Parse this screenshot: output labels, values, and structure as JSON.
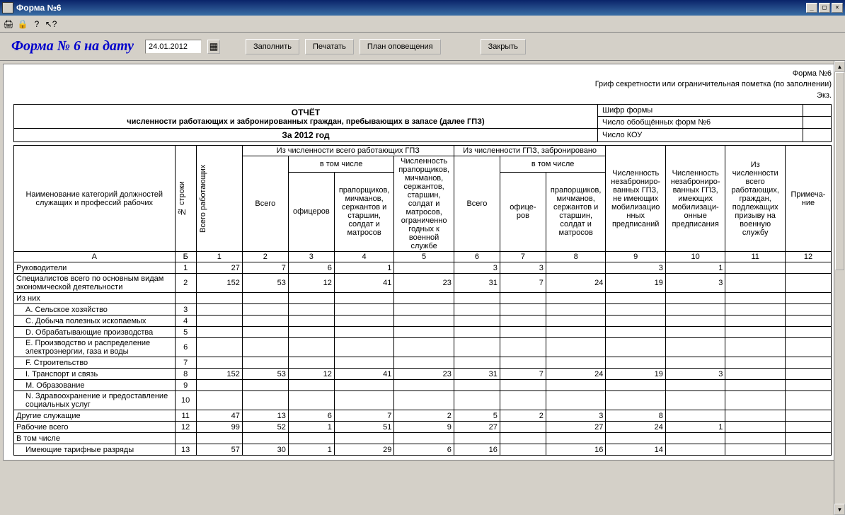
{
  "window": {
    "title": "Форма №6"
  },
  "toolbar_icons": [
    "print-icon",
    "lock-icon",
    "help-icon",
    "pointer-icon"
  ],
  "panel": {
    "title": "Форма № 6 на дату",
    "date": "24.01.2012",
    "fill_btn": "Заполнить",
    "print_btn": "Печатать",
    "plan_btn": "План оповещения",
    "close_btn": "Закрыть"
  },
  "header_right": {
    "line1": "Форма №6",
    "line2": "Гриф секретности или ограничительная пометка (по заполнении)",
    "line3": "Экз."
  },
  "report_header": {
    "title1": "ОТЧЁТ",
    "title2": "численности работающих и забронированных граждан, пребывающих в запасе (далее ГПЗ)",
    "title3": "За 2012 год",
    "meta": [
      {
        "label": "Шифр формы",
        "value": ""
      },
      {
        "label": "Число обобщённых форм №6",
        "value": ""
      },
      {
        "label": "Число КОУ",
        "value": ""
      }
    ]
  },
  "columns": {
    "name": "Наименование категорий должностей служащих и профессий рабочих",
    "row_no": "№ строки",
    "total": "Всего работающих",
    "group1": "Из численности всего работающих ГПЗ",
    "group2": "Из численности ГПЗ, забронировано",
    "subgroup": "в том числе",
    "vsego": "Всего",
    "officers": "офицеров",
    "prapor": "прапорщиков, мичманов, сержантов и старшин, солдат и матросов",
    "limited": "Численность прапорщиков, мичманов, сержантов, старшин, солдат и матросов, ограниченно годных к военной службе",
    "officers2": "офице- ров",
    "col9": "Численность незаброниро- ванных ГПЗ, не имеющих мобилизацио нных предписаний",
    "col10": "Численность незаброниро- ванных ГПЗ, имеющих мобилизаци- онные предписания",
    "col11": "Из численности всего работающих, граждан, подлежащих призыву на военную службу",
    "col12": "Примеча- ние",
    "letter_a": "А",
    "letter_b": "Б",
    "nums": [
      "1",
      "2",
      "3",
      "4",
      "5",
      "6",
      "7",
      "8",
      "9",
      "10",
      "11",
      "12"
    ]
  },
  "rows": [
    {
      "name": "Руководители",
      "indent": 0,
      "no": "1",
      "v": [
        "27",
        "7",
        "6",
        "1",
        "",
        "3",
        "3",
        "",
        "3",
        "1",
        "",
        ""
      ]
    },
    {
      "name": "Специалистов всего по основным видам экономической деятельности",
      "indent": 0,
      "no": "2",
      "v": [
        "152",
        "53",
        "12",
        "41",
        "23",
        "31",
        "7",
        "24",
        "19",
        "3",
        "",
        ""
      ]
    },
    {
      "name": "Из них",
      "indent": 0,
      "no": "",
      "v": [
        "",
        "",
        "",
        "",
        "",
        "",
        "",
        "",
        "",
        "",
        "",
        ""
      ]
    },
    {
      "name": "A. Сельское хозяйство",
      "indent": 1,
      "no": "3",
      "v": [
        "",
        "",
        "",
        "",
        "",
        "",
        "",
        "",
        "",
        "",
        "",
        ""
      ]
    },
    {
      "name": "C. Добыча полезных ископаемых",
      "indent": 1,
      "no": "4",
      "v": [
        "",
        "",
        "",
        "",
        "",
        "",
        "",
        "",
        "",
        "",
        "",
        ""
      ]
    },
    {
      "name": "D. Обрабатывающие производства",
      "indent": 1,
      "no": "5",
      "v": [
        "",
        "",
        "",
        "",
        "",
        "",
        "",
        "",
        "",
        "",
        "",
        ""
      ]
    },
    {
      "name": "E. Производство и распределение электроэнергии, газа и воды",
      "indent": 1,
      "no": "6",
      "v": [
        "",
        "",
        "",
        "",
        "",
        "",
        "",
        "",
        "",
        "",
        "",
        ""
      ]
    },
    {
      "name": "F. Строительство",
      "indent": 1,
      "no": "7",
      "v": [
        "",
        "",
        "",
        "",
        "",
        "",
        "",
        "",
        "",
        "",
        "",
        ""
      ]
    },
    {
      "name": "I. Транспорт и связь",
      "indent": 1,
      "no": "8",
      "v": [
        "152",
        "53",
        "12",
        "41",
        "23",
        "31",
        "7",
        "24",
        "19",
        "3",
        "",
        ""
      ]
    },
    {
      "name": "M. Образование",
      "indent": 1,
      "no": "9",
      "v": [
        "",
        "",
        "",
        "",
        "",
        "",
        "",
        "",
        "",
        "",
        "",
        ""
      ]
    },
    {
      "name": "N. Здравоохранение и предоставление социальных услуг",
      "indent": 1,
      "no": "10",
      "v": [
        "",
        "",
        "",
        "",
        "",
        "",
        "",
        "",
        "",
        "",
        "",
        ""
      ]
    },
    {
      "name": "Другие служащие",
      "indent": 0,
      "no": "11",
      "v": [
        "47",
        "13",
        "6",
        "7",
        "2",
        "5",
        "2",
        "3",
        "8",
        "",
        "",
        ""
      ]
    },
    {
      "name": "Рабочие всего",
      "indent": 0,
      "no": "12",
      "v": [
        "99",
        "52",
        "1",
        "51",
        "9",
        "27",
        "",
        "27",
        "24",
        "1",
        "",
        ""
      ]
    },
    {
      "name": "В том числе",
      "indent": 0,
      "no": "",
      "v": [
        "",
        "",
        "",
        "",
        "",
        "",
        "",
        "",
        "",
        "",
        "",
        ""
      ]
    },
    {
      "name": "Имеющие тарифные разряды",
      "indent": 1,
      "no": "13",
      "v": [
        "57",
        "30",
        "1",
        "29",
        "6",
        "16",
        "",
        "16",
        "14",
        "",
        "",
        ""
      ]
    }
  ]
}
